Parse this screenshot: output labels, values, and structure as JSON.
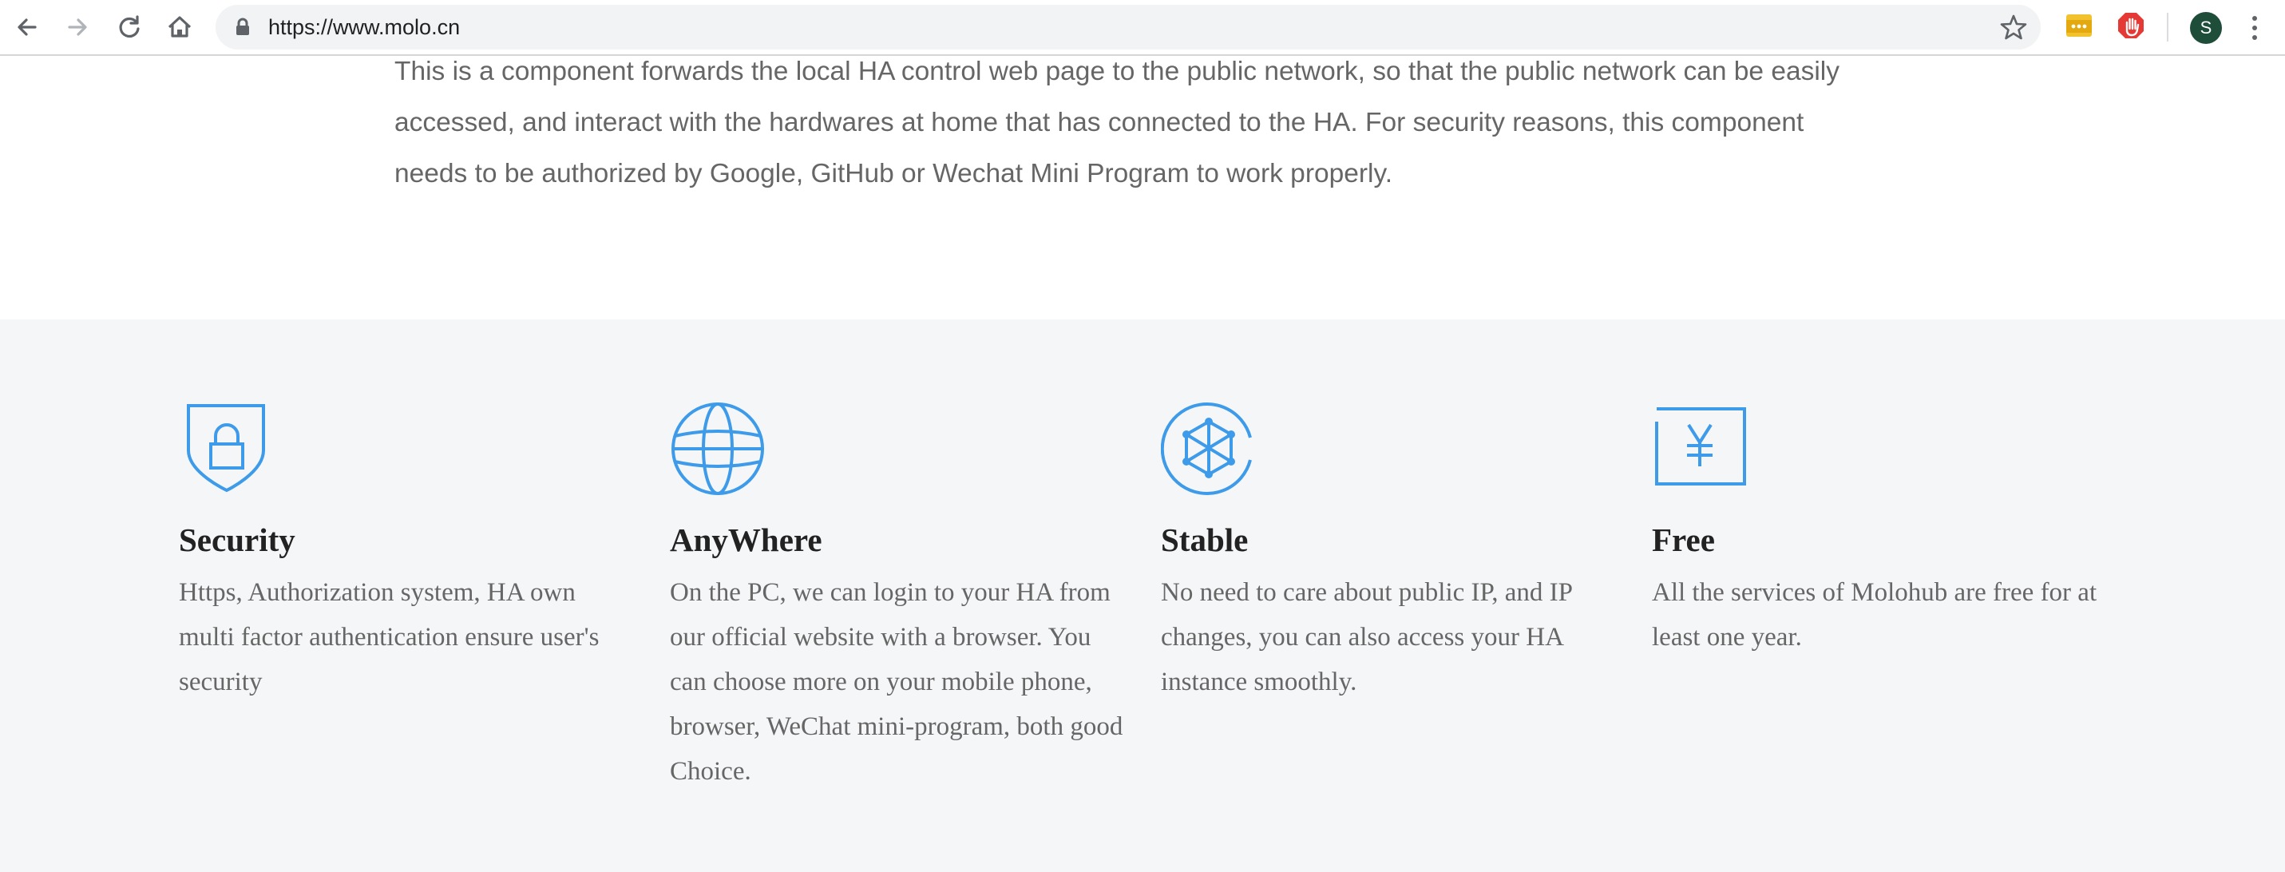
{
  "browser": {
    "url": "https://www.molo.cn",
    "profile_initial": "S",
    "icons": [
      "back-arrow-icon",
      "forward-arrow-icon",
      "reload-icon",
      "home-icon",
      "lock-icon",
      "bookmark-star-icon",
      "extension-icon",
      "adblock-icon",
      "menu-icon"
    ]
  },
  "intro": {
    "text": "This is a component forwards the local HA control web page to the public network, so that the public network can be easily accessed, and interact with the hardwares at home that has connected to the HA. For security reasons, this component needs to be authorized by Google, GitHub or Wechat Mini Program to work properly."
  },
  "features": [
    {
      "icon": "shield-lock-icon",
      "title": "Security",
      "description": "Https, Authorization system, HA own multi factor authentication ensure user's security"
    },
    {
      "icon": "globe-icon",
      "title": "AnyWhere",
      "description": "On the PC, we can login to your HA from our official website with a browser. You can choose more on your mobile phone, browser, WeChat mini-program, both good Choice."
    },
    {
      "icon": "network-node-icon",
      "title": "Stable",
      "description": "No need to care about public IP, and IP changes, you can also access your HA instance smoothly."
    },
    {
      "icon": "yen-icon",
      "title": "Free",
      "description": "All the services of Molohub are free for at least one year."
    }
  ],
  "colors": {
    "accent": "#3d9be9",
    "features_background": "#f5f6f8",
    "body_text": "#666666",
    "heading_text": "#222222"
  }
}
